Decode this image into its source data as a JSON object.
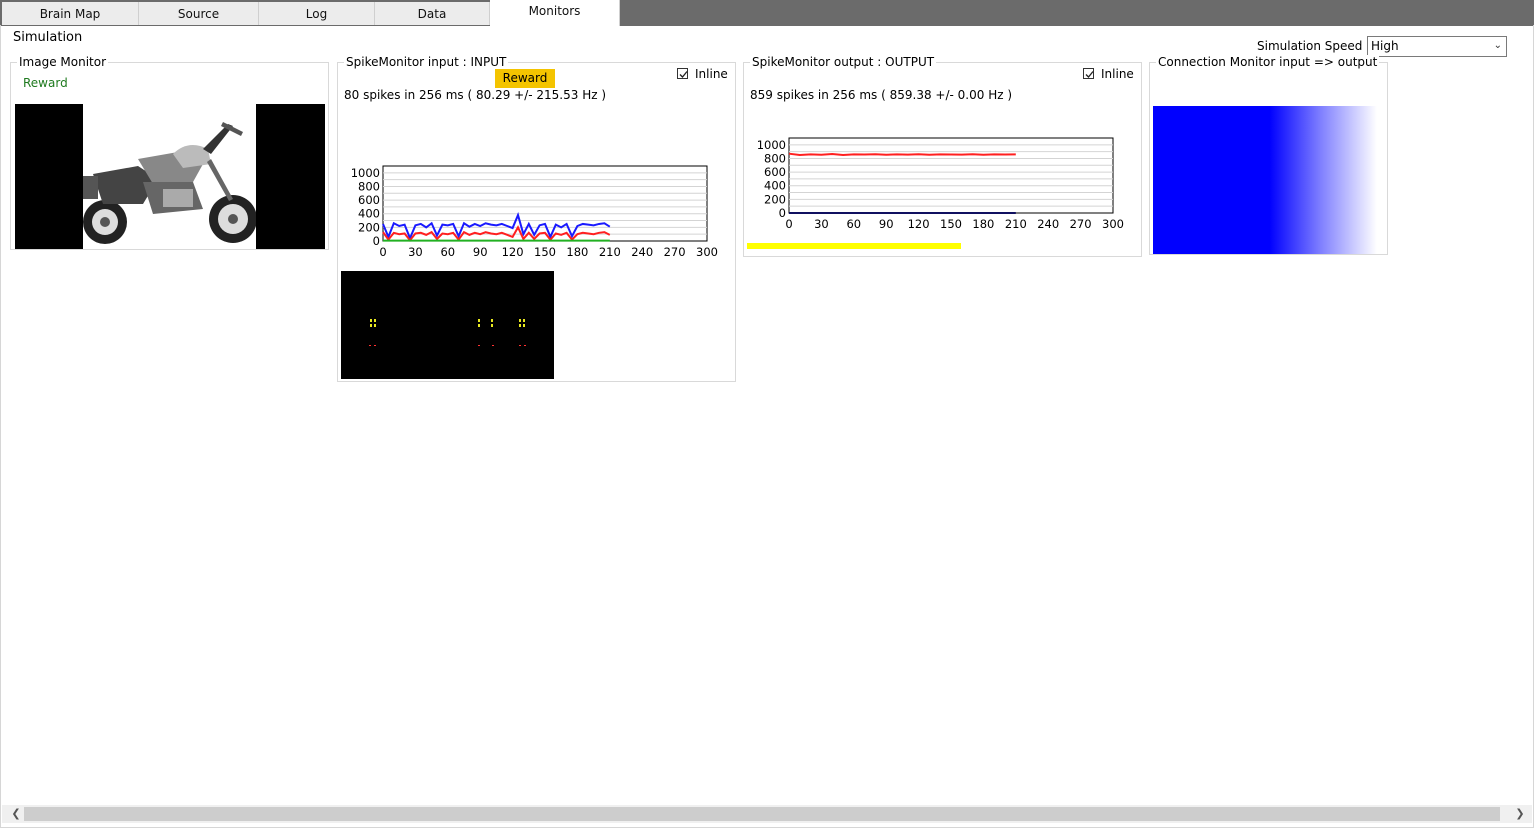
{
  "tabs": [
    {
      "label": "Brain Map",
      "active": false
    },
    {
      "label": "Source",
      "active": false
    },
    {
      "label": "Log",
      "active": false
    },
    {
      "label": "Data",
      "active": false
    },
    {
      "label": "Monitors",
      "active": true
    }
  ],
  "section_title": "Simulation",
  "simulation_speed": {
    "label": "Simulation Speed",
    "value": "High"
  },
  "image_monitor": {
    "title": "Image Monitor",
    "reward_label": "Reward"
  },
  "spike_input": {
    "title": "SpikeMonitor input : INPUT",
    "badge": "Reward",
    "inline_label": "Inline",
    "inline_checked": true,
    "stats": "80 spikes in 256 ms (  80.29 +/- 215.53 Hz )"
  },
  "spike_output": {
    "title": "SpikeMonitor output : OUTPUT",
    "inline_label": "Inline",
    "inline_checked": true,
    "stats": "859 spikes in 256 ms ( 859.38 +/-   0.00 Hz )"
  },
  "connection_monitor": {
    "title": "Connection Monitor input => output"
  },
  "colors": {
    "series_blue": "#1a1aff",
    "series_red": "#ff2020",
    "series_green": "#22b022",
    "badge": "#f4c400",
    "progress": "#ffff00"
  },
  "chart_data": [
    {
      "type": "line",
      "title": "",
      "xlabel": "",
      "ylabel": "",
      "x_ticks": [
        "0",
        "30",
        "60",
        "90",
        "120",
        "150",
        "180",
        "210",
        "240",
        "270",
        "300"
      ],
      "y_ticks": [
        "0",
        "200",
        "400",
        "600",
        "800",
        "1000"
      ],
      "xlim": [
        0,
        300
      ],
      "ylim": [
        0,
        1100
      ],
      "grid": true,
      "x": [
        0,
        5,
        10,
        15,
        20,
        25,
        30,
        35,
        40,
        45,
        50,
        55,
        60,
        65,
        70,
        75,
        80,
        85,
        90,
        95,
        100,
        105,
        110,
        115,
        120,
        125,
        130,
        135,
        140,
        145,
        150,
        155,
        160,
        165,
        170,
        175,
        180,
        185,
        190,
        195,
        200,
        205,
        210
      ],
      "series": [
        {
          "color": "blue",
          "values": [
            250,
            60,
            260,
            220,
            240,
            40,
            230,
            250,
            200,
            260,
            80,
            240,
            230,
            250,
            70,
            260,
            210,
            250,
            220,
            260,
            240,
            230,
            250,
            220,
            190,
            380,
            100,
            250,
            90,
            230,
            250,
            60,
            240,
            200,
            250,
            70,
            220,
            250,
            240,
            230,
            250,
            260,
            210
          ]
        },
        {
          "color": "red",
          "values": [
            130,
            20,
            120,
            100,
            110,
            10,
            110,
            120,
            90,
            130,
            30,
            110,
            100,
            120,
            20,
            130,
            90,
            120,
            100,
            130,
            110,
            100,
            120,
            90,
            60,
            200,
            30,
            120,
            30,
            110,
            120,
            20,
            110,
            90,
            120,
            20,
            100,
            120,
            110,
            100,
            120,
            130,
            90
          ]
        },
        {
          "color": "green",
          "values": [
            5,
            5,
            5,
            5,
            5,
            5,
            5,
            5,
            5,
            5,
            5,
            5,
            5,
            5,
            5,
            5,
            5,
            5,
            5,
            5,
            5,
            5,
            5,
            5,
            5,
            5,
            5,
            5,
            5,
            5,
            5,
            5,
            5,
            5,
            5,
            5,
            5,
            5,
            5,
            5,
            5,
            5,
            5
          ]
        }
      ]
    },
    {
      "type": "line",
      "title": "",
      "xlabel": "",
      "ylabel": "",
      "x_ticks": [
        "0",
        "30",
        "60",
        "90",
        "120",
        "150",
        "180",
        "210",
        "240",
        "270",
        "300"
      ],
      "y_ticks": [
        "0",
        "200",
        "400",
        "600",
        "800",
        "1000"
      ],
      "xlim": [
        0,
        300
      ],
      "ylim": [
        0,
        1100
      ],
      "grid": true,
      "x": [
        0,
        10,
        20,
        30,
        40,
        50,
        60,
        70,
        80,
        90,
        100,
        110,
        120,
        130,
        140,
        150,
        160,
        170,
        180,
        190,
        200,
        210
      ],
      "series": [
        {
          "color": "red",
          "values": [
            870,
            850,
            860,
            855,
            865,
            850,
            860,
            858,
            862,
            855,
            860,
            857,
            862,
            855,
            860,
            858,
            856,
            862,
            855,
            860,
            858,
            860
          ]
        },
        {
          "color": "navy",
          "values": [
            0,
            0,
            0,
            0,
            0,
            0,
            0,
            0,
            0,
            0,
            0,
            0,
            0,
            0,
            0,
            0,
            0,
            0,
            0,
            0,
            0,
            0
          ]
        }
      ]
    }
  ]
}
